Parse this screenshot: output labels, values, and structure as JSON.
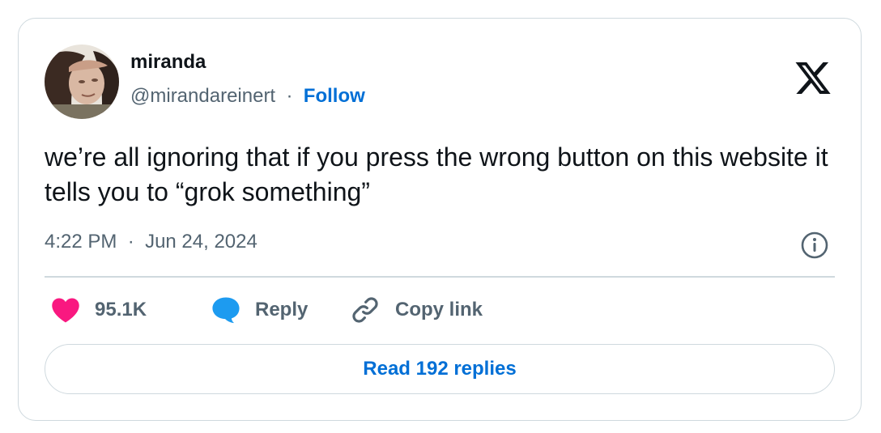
{
  "author": {
    "name": "miranda",
    "handle": "@mirandareinert",
    "separator": "·",
    "follow_label": "Follow"
  },
  "tweet": {
    "text": "we’re all ignoring that if you press the wrong button on this website it tells you to “grok something”",
    "time": "4:22 PM",
    "date_separator": "·",
    "date": "Jun 24, 2024"
  },
  "actions": {
    "like_count": "95.1K",
    "reply_label": "Reply",
    "copy_link_label": "Copy link"
  },
  "read_replies_label": "Read 192 replies",
  "icons": {
    "brand": "x-logo-icon",
    "info": "info-icon",
    "like": "heart-icon",
    "reply": "speech-bubble-icon",
    "copy": "link-icon"
  },
  "colors": {
    "text": "#0f1419",
    "secondary": "#536471",
    "accent": "#006fd6",
    "like": "#f91880",
    "reply": "#1d9bf0",
    "border": "#cfd9de"
  }
}
